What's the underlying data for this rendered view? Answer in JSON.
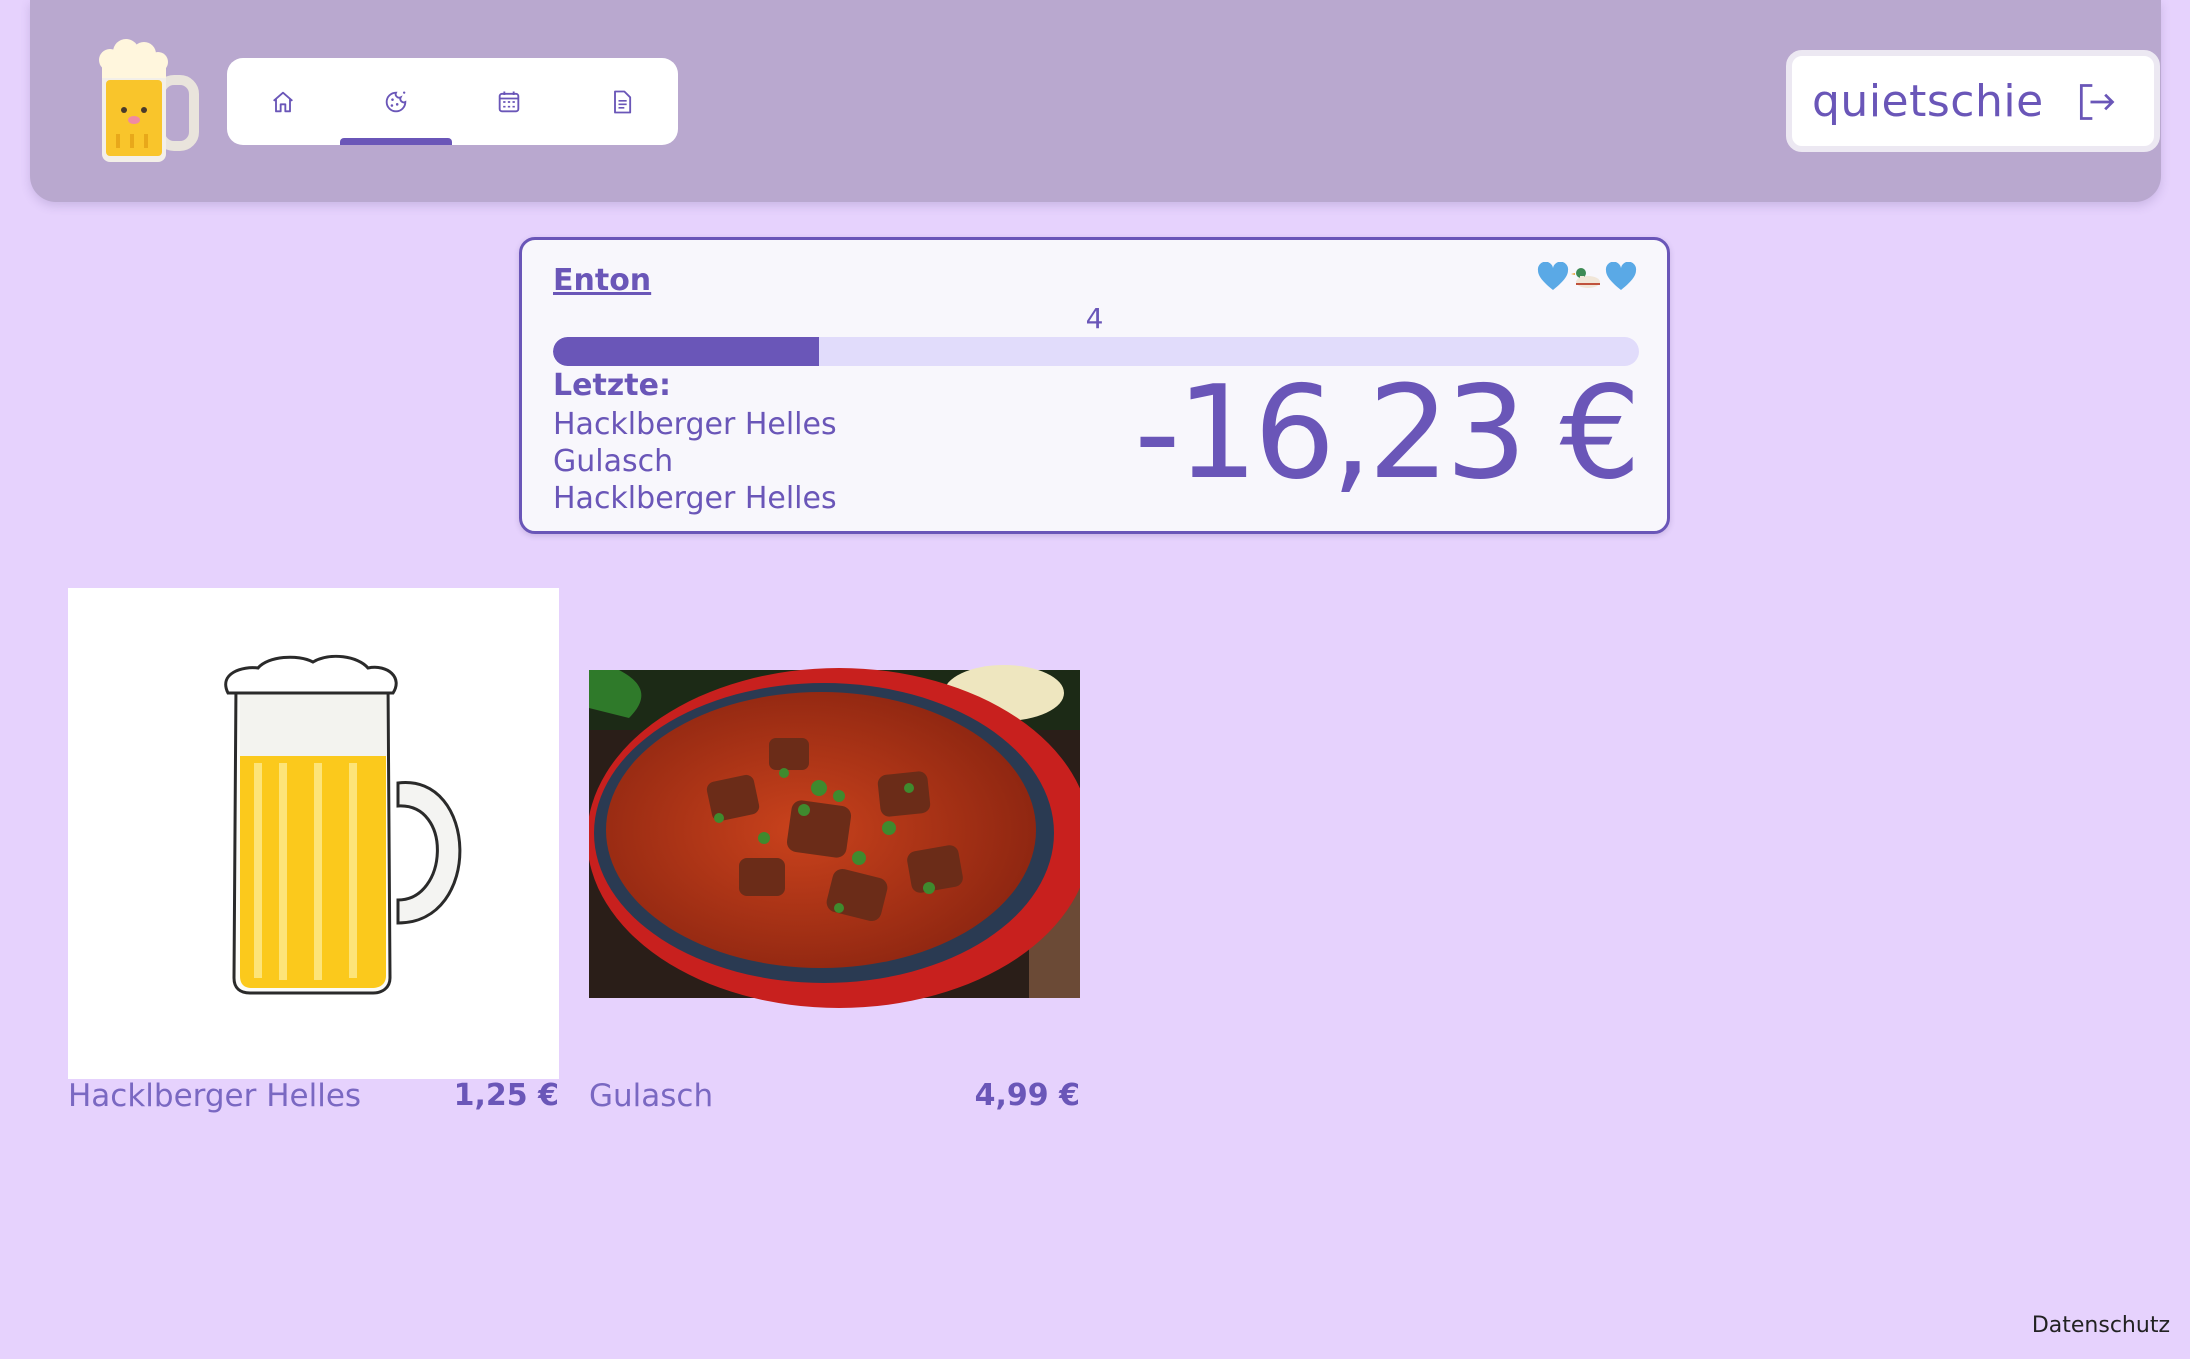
{
  "header": {
    "logo": "beer-mug-logo",
    "nav": [
      {
        "icon": "home-icon",
        "active": false
      },
      {
        "icon": "cookie-icon",
        "active": true
      },
      {
        "icon": "calendar-icon",
        "active": false
      },
      {
        "icon": "document-icon",
        "active": false
      }
    ],
    "user": {
      "name": "quietschie",
      "icon": "logout-icon"
    }
  },
  "account_card": {
    "name": "Enton",
    "badges": [
      "blue-heart-icon",
      "duck-icon",
      "blue-heart-icon"
    ],
    "level": "4",
    "progress": 0.245,
    "last_label": "Letzte:",
    "last_items": [
      "Hacklberger Helles",
      "Gulasch",
      "Hacklberger Helles"
    ],
    "balance": "-16,23 €"
  },
  "products": [
    {
      "name": "Hacklberger Helles",
      "price": "1,25 €",
      "image": "beer-mug-image"
    },
    {
      "name": "Gulasch",
      "price": "4,99 €",
      "image": "goulash-image"
    }
  ],
  "footer": {
    "privacy_label": "Datenschutz"
  },
  "colors": {
    "accent": "#6a56b8",
    "background": "#e6d2fd",
    "header": "#b9a8cf"
  }
}
